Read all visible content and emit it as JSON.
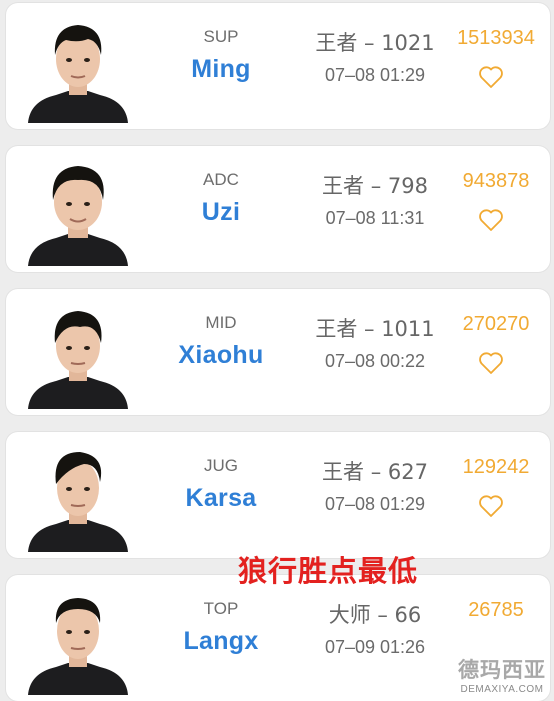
{
  "colors": {
    "name": "#2f7fd6",
    "score": "#f1aa33",
    "overlay": "#e3211f"
  },
  "players": [
    {
      "role": "SUP",
      "name": "Ming",
      "rank": "王者 – 1021",
      "time": "07–08 01:29",
      "score": "1513934",
      "icon": "heart-outline-icon"
    },
    {
      "role": "ADC",
      "name": "Uzi",
      "rank": "王者 – 798",
      "time": "07–08 11:31",
      "score": "943878",
      "icon": "heart-outline-icon"
    },
    {
      "role": "MID",
      "name": "Xiaohu",
      "rank": "王者 – 1011",
      "time": "07–08 00:22",
      "score": "270270",
      "icon": "heart-outline-icon"
    },
    {
      "role": "JUG",
      "name": "Karsa",
      "rank": "王者 – 627",
      "time": "07–08 01:29",
      "score": "129242",
      "icon": "heart-outline-icon"
    },
    {
      "role": "TOP",
      "name": "Langx",
      "rank": "大师 – 66",
      "time": "07–09 01:26",
      "score": "26785",
      "icon": "heart-outline-icon"
    }
  ],
  "overlay_text": "狼行胜点最低",
  "watermark": {
    "cn": "德玛西亚",
    "en": "DEMAXIYA.COM"
  }
}
